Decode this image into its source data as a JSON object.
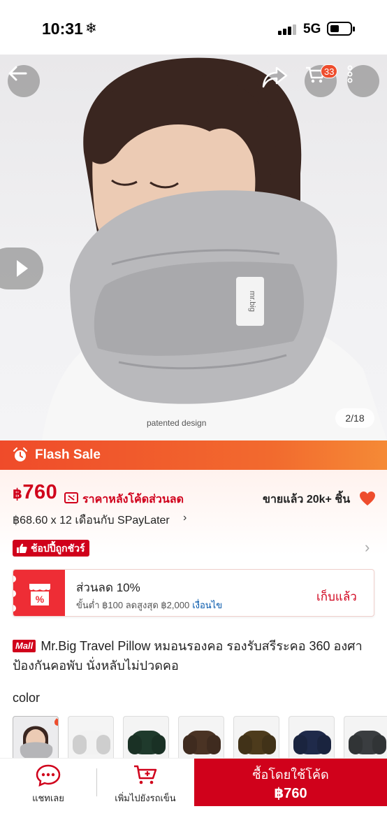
{
  "status_bar": {
    "time": "10:31",
    "weather_icon": "snowflake-icon",
    "network": "5G"
  },
  "header": {
    "cart_count": "33"
  },
  "gallery": {
    "caption": "patented design",
    "counter": "2/18"
  },
  "flash_sale": {
    "label": "Flash Sale",
    "icon": "alarm-clock-icon"
  },
  "price": {
    "currency": "฿",
    "amount": "760",
    "note": "ราคาหลังโค้ดส่วนลด",
    "sold": "ขายแล้ว 20k+ ชิ้น",
    "installment": "฿68.60 x 12 เดือนกับ SPayLater",
    "installment_chevron": "›",
    "guarantee": "ช้อปปี้ถูกชัวร์",
    "guarantee_chevron": "›"
  },
  "voucher": {
    "title": "ส่วนลด 10%",
    "min": "ขั้นต่ำ ฿100 ลดสูงสุด ฿2,000",
    "conditions": "เงื่อนไข",
    "action": "เก็บแล้ว"
  },
  "product": {
    "mall_badge": "Mall",
    "title": "Mr.Big Travel Pillow หมอนรองคอ รองรับสรีระคอ 360 องศา ป้องกันคอพับ นั่งหลับไม่ปวดคอ"
  },
  "variants": {
    "label": "color",
    "colors": [
      "#b5b5b8",
      "#f2f2f2",
      "#1f3a2c",
      "#4a3324",
      "#4d3b1c",
      "#1f2a4a",
      "#3a3d40"
    ]
  },
  "bottom_bar": {
    "chat_label": "แชทเลย",
    "add_cart_label": "เพิ่มไปยังรถเข็น",
    "buy_label": "ซื้อโดยใช้โค้ด",
    "buy_price": "฿760"
  },
  "colors": {
    "accent": "#d0011b",
    "flash": "#ee4d2d"
  }
}
